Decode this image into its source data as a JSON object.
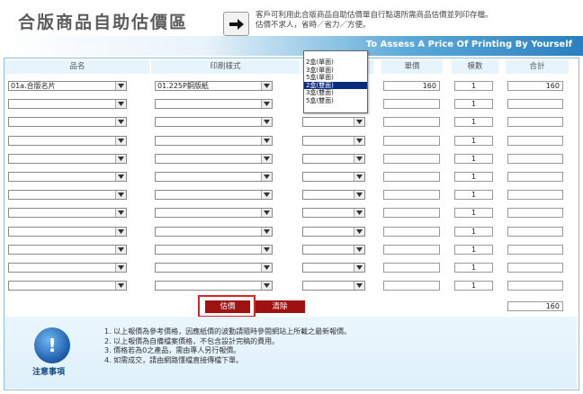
{
  "header": {
    "title": "合版商品自助估價區",
    "desc_line1": "客戶可利用此合版商品自助估價單自行點選所需商品估價並列印存檔。",
    "desc_line2": "估價不求人，省時／省力／方便。",
    "subtitle": "To Assess A Price Of Printing By Yourself"
  },
  "table": {
    "columns": [
      "品名",
      "印刷樣式",
      "",
      "單價",
      "模數",
      "合計"
    ],
    "rows": [
      {
        "product": "01a.合版名片",
        "style": "01.225P銅版紙",
        "option": "",
        "unit_price": "160",
        "qty": "1",
        "total": "160"
      },
      {
        "product": "",
        "style": "",
        "option": "",
        "unit_price": "",
        "qty": "1",
        "total": ""
      },
      {
        "product": "",
        "style": "",
        "option": "",
        "unit_price": "",
        "qty": "1",
        "total": ""
      },
      {
        "product": "",
        "style": "",
        "option": "",
        "unit_price": "",
        "qty": "1",
        "total": ""
      },
      {
        "product": "",
        "style": "",
        "option": "",
        "unit_price": "",
        "qty": "1",
        "total": ""
      },
      {
        "product": "",
        "style": "",
        "option": "",
        "unit_price": "",
        "qty": "1",
        "total": ""
      },
      {
        "product": "",
        "style": "",
        "option": "",
        "unit_price": "",
        "qty": "1",
        "total": ""
      },
      {
        "product": "",
        "style": "",
        "option": "",
        "unit_price": "",
        "qty": "1",
        "total": ""
      },
      {
        "product": "",
        "style": "",
        "option": "",
        "unit_price": "",
        "qty": "1",
        "total": ""
      },
      {
        "product": "",
        "style": "",
        "option": "",
        "unit_price": "",
        "qty": "1",
        "total": ""
      },
      {
        "product": "",
        "style": "",
        "option": "",
        "unit_price": "",
        "qty": "1",
        "total": ""
      },
      {
        "product": "",
        "style": "",
        "option": "",
        "unit_price": "",
        "qty": "1",
        "total": ""
      }
    ]
  },
  "dropdown_options": [
    "2盒(單面)",
    "3盒(單面)",
    "5盒(單面)",
    "2盒(雙面)",
    "3盒(雙面)",
    "5盒(雙面)"
  ],
  "dropdown_active_index": 3,
  "buttons": {
    "estimate": "估價",
    "clear": "清除"
  },
  "grand_total": "160",
  "notes": {
    "label": "注意事項",
    "lines": [
      "1. 以上報價為參考價格，因應紙價的波動請隨時參閱網站上所載之最新報價。",
      "2. 以上報價為自備檔案價格，不包含設計完稿的費用。",
      "3. 價格若為0之產品，需由專人另行報價。",
      "4. 如需成交，請由網路懂檔直接傳檔下單。"
    ]
  }
}
